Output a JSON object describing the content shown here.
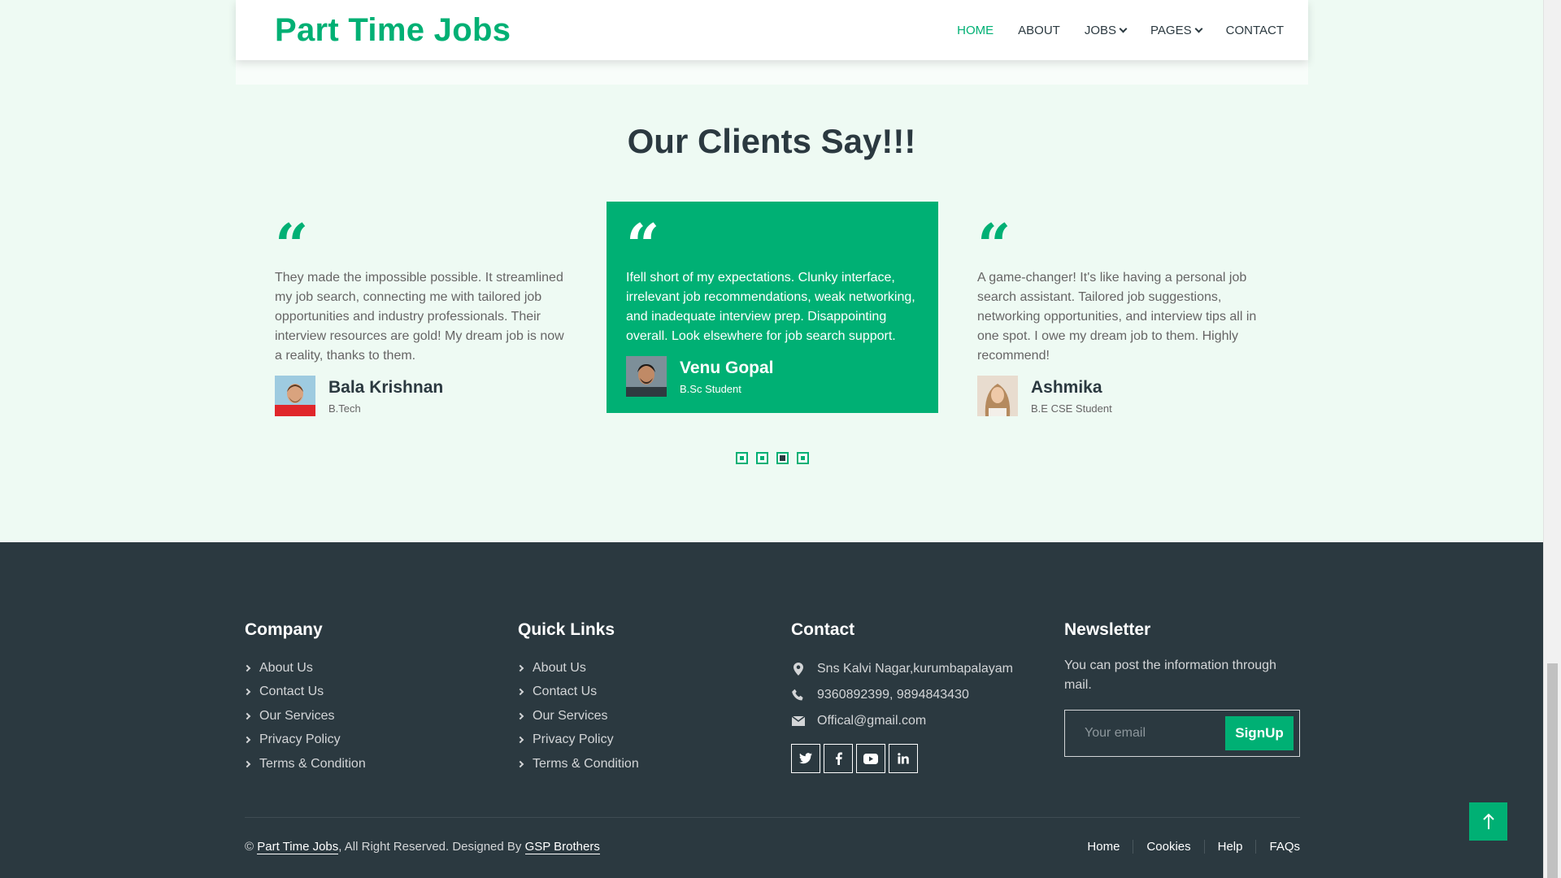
{
  "navbar": {
    "logo": "Part Time Jobs",
    "items": [
      {
        "label": "HOME",
        "active": true,
        "dropdown": false
      },
      {
        "label": "ABOUT",
        "active": false,
        "dropdown": false
      },
      {
        "label": "JOBS",
        "active": false,
        "dropdown": true
      },
      {
        "label": "PAGES",
        "active": false,
        "dropdown": true
      },
      {
        "label": "CONTACT",
        "active": false,
        "dropdown": false
      }
    ]
  },
  "testimonials": {
    "title": "Our Clients Say!!!",
    "items": [
      {
        "text": "They made the impossible possible. It streamlined my job search, connecting me with tailored job opportunities and industry professionals. Their interview resources are gold! My dream job is now a reality, thanks to them.",
        "name": "Bala Krishnan",
        "role": "B.Tech"
      },
      {
        "text": "Ifell short of my expectations. Clunky interface, irrelevant job recommendations, weak networking, and inadequate interview prep. Disappointing overall. Look elsewhere for job search support.",
        "name": "Venu Gopal",
        "role": "B.Sc Student"
      },
      {
        "text": "A game-changer! It's like having a personal job search assistant. Tailored job suggestions, networking opportunities, and interview tips all in one spot. I owe my dream job to them. Highly recommend!",
        "name": "Ashmika",
        "role": "B.E CSE Student"
      }
    ],
    "dots": 4,
    "active_dot": 2
  },
  "footer": {
    "company": {
      "heading": "Company",
      "links": [
        "About Us",
        "Contact Us",
        "Our Services",
        "Privacy Policy",
        "Terms & Condition"
      ]
    },
    "quick_links": {
      "heading": "Quick Links",
      "links": [
        "About Us",
        "Contact Us",
        "Our Services",
        "Privacy Policy",
        "Terms & Condition"
      ]
    },
    "contact": {
      "heading": "Contact",
      "address": "Sns Kalvi Nagar,kurumbapalayam",
      "phone": "9360892399, 9894843430",
      "email": "Offical@gmail.com",
      "social": [
        "twitter-icon",
        "facebook-icon",
        "youtube-icon",
        "linkedin-icon"
      ]
    },
    "newsletter": {
      "heading": "Newsletter",
      "text": "You can post the information through mail.",
      "placeholder": "Your email",
      "button": "SignUp"
    },
    "copyright": {
      "prefix": "©",
      "brand": "Part Time Jobs",
      "middle": ", All Right Reserved. Designed By",
      "designer": "GSP Brothers"
    },
    "menu": [
      "Home",
      "Cookies",
      "Help",
      "FAQs"
    ]
  },
  "colors": {
    "accent": "#00b074",
    "dark": "#2b3940",
    "background": "#eefaf3"
  }
}
